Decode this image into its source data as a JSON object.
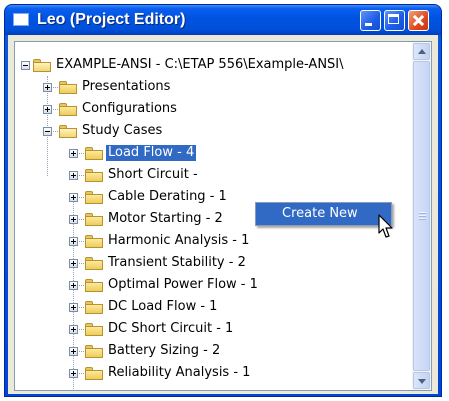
{
  "window": {
    "title": "Leo (Project Editor)"
  },
  "tree": {
    "root": {
      "label": "EXAMPLE-ANSI - C:\\ETAP 556\\Example-ANSI\\"
    },
    "level1": [
      {
        "label": "Presentations",
        "expanded": false
      },
      {
        "label": "Configurations",
        "expanded": false
      },
      {
        "label": "Study Cases",
        "expanded": true
      }
    ],
    "study_cases": [
      {
        "label": "Load Flow - 4",
        "selected": true
      },
      {
        "label": "Short Circuit -"
      },
      {
        "label": "Cable Derating - 1"
      },
      {
        "label": "Motor Starting - 2"
      },
      {
        "label": "Harmonic Analysis - 1"
      },
      {
        "label": "Transient Stability - 2"
      },
      {
        "label": "Optimal Power Flow - 1"
      },
      {
        "label": "DC Load Flow - 1"
      },
      {
        "label": "DC Short Circuit - 1"
      },
      {
        "label": "Battery Sizing - 2"
      },
      {
        "label": "Reliability Analysis - 1"
      }
    ]
  },
  "context_menu": {
    "items": [
      {
        "label": "Create New"
      }
    ]
  },
  "colors": {
    "selection": "#316ac5",
    "titlebar": "#0053e1",
    "window_bg": "#ece9d8"
  }
}
